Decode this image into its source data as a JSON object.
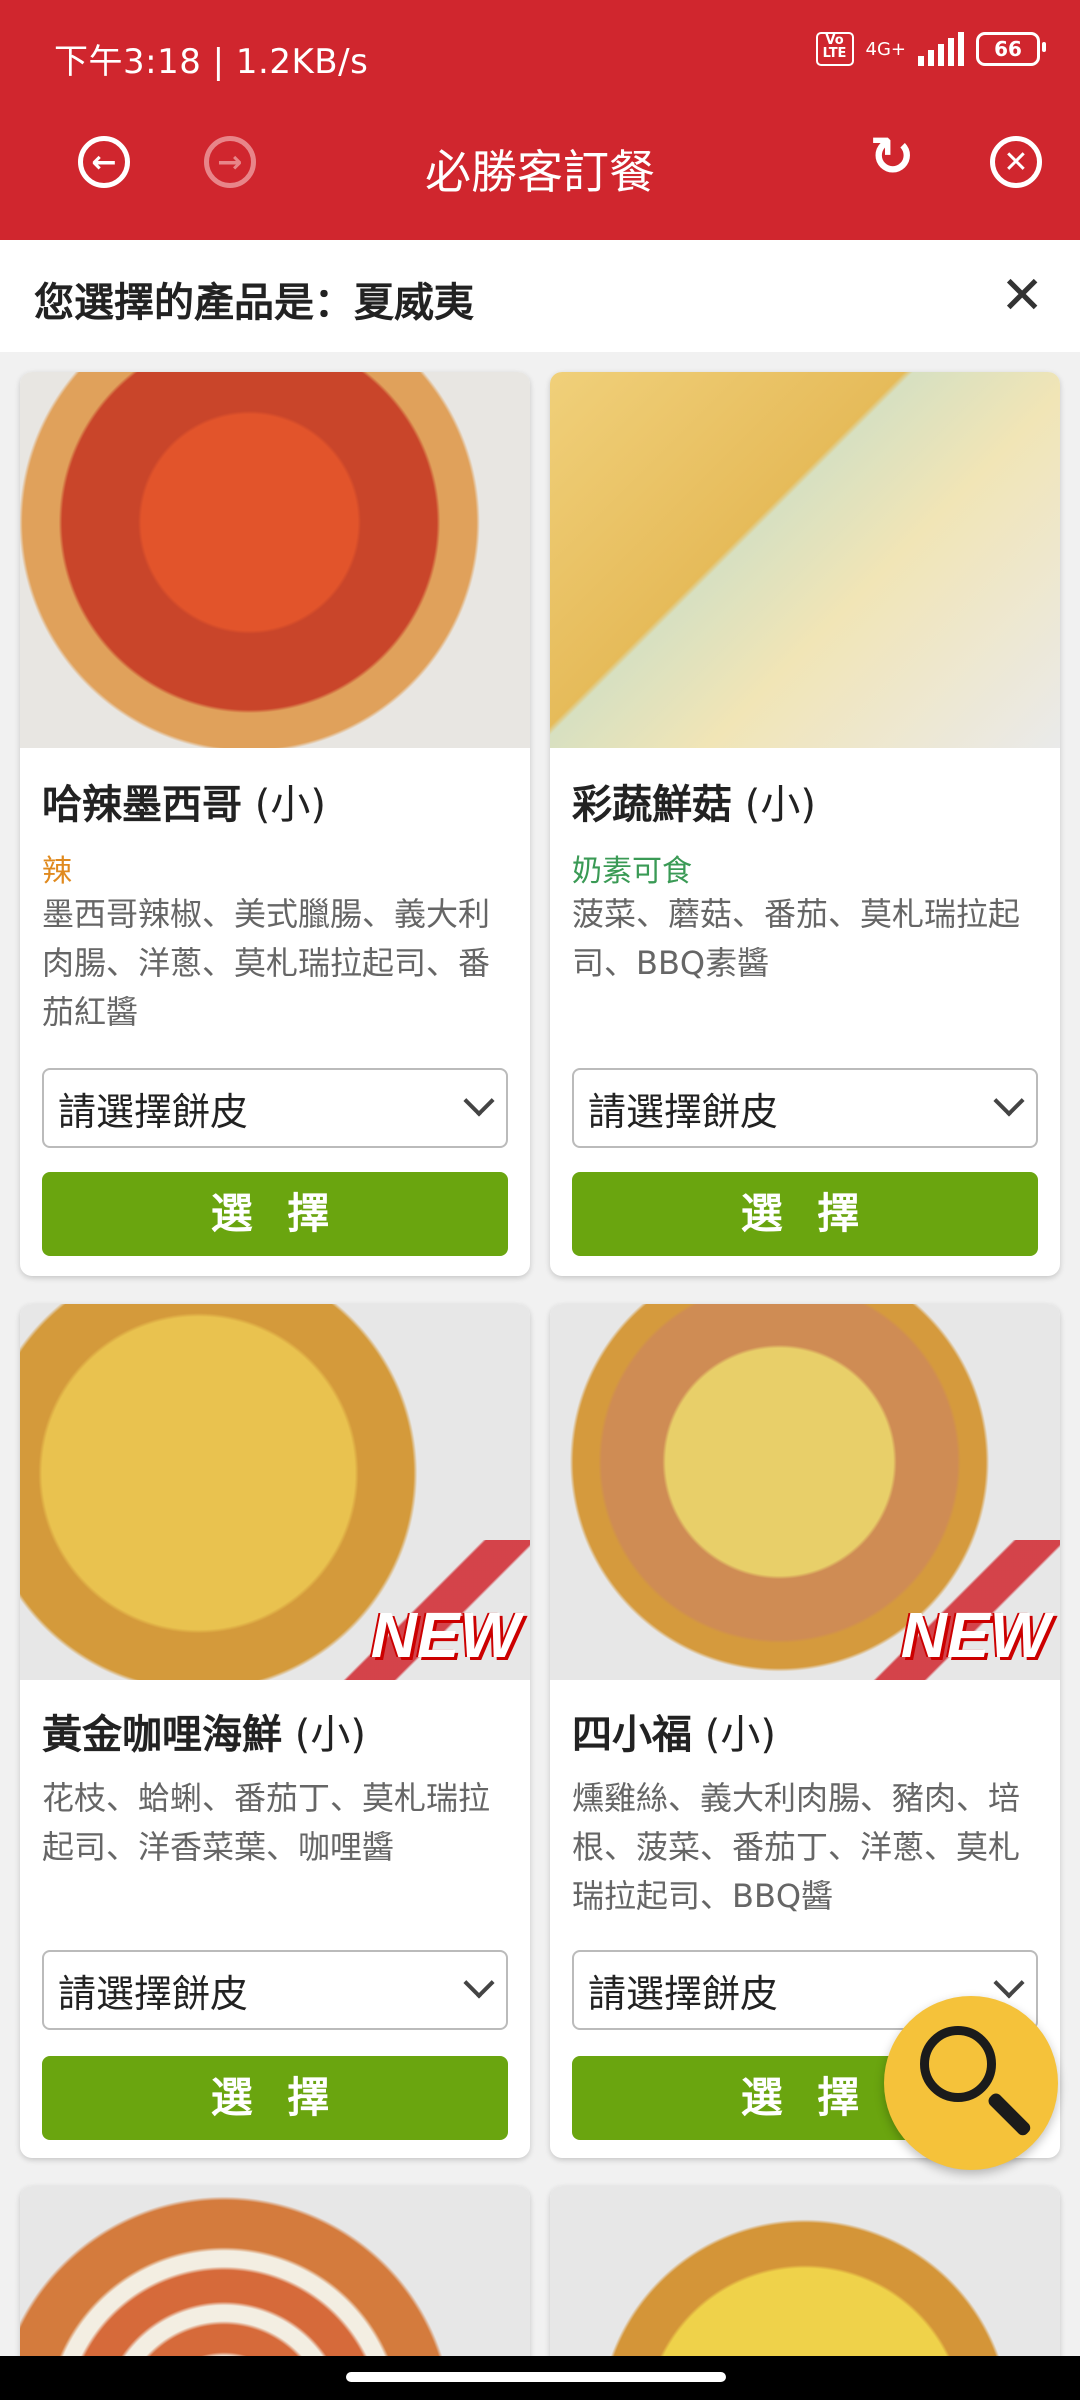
{
  "status_bar": {
    "time_speed": "下午3:18 | 1.2KB/s",
    "volte": "Vo LTE",
    "network": "4G+",
    "battery": "66"
  },
  "header": {
    "title": "必勝客訂餐",
    "icons": [
      "back-icon",
      "forward-icon",
      "refresh-icon",
      "close-icon"
    ],
    "color": "#d0262e"
  },
  "selection": {
    "text": "您選擇的產品是：夏威夷",
    "close": "✕"
  },
  "products": [
    {
      "name": "哈辣墨西哥",
      "size": "(小)",
      "tag": "辣",
      "tag_color": "#e08a1e",
      "desc": "墨西哥辣椒、美式臘腸、義大利肉腸、洋蔥、莫札瑞拉起司、番茄紅醬",
      "select": "請選擇餅皮",
      "button": "選 擇",
      "new": false
    },
    {
      "name": "彩蔬鮮菇",
      "size": "(小)",
      "tag": "奶素可食",
      "tag_color": "#3a9a55",
      "desc": "菠菜、蘑菇、番茄、莫札瑞拉起司、BBQ素醬",
      "select": "請選擇餅皮",
      "button": "選 擇",
      "new": false
    },
    {
      "name": "黃金咖哩海鮮",
      "size": "(小)",
      "tag": "",
      "tag_color": "",
      "desc": "花枝、蛤蜊、番茄丁、莫札瑞拉起司、洋香菜葉、咖哩醬",
      "select": "請選擇餅皮",
      "button": "選 擇",
      "new": true
    },
    {
      "name": "四小福",
      "size": "(小)",
      "tag": "",
      "tag_color": "",
      "desc": "燻雞絲、義大利肉腸、豬肉、培根、菠菜、番茄丁、洋蔥、莫札瑞拉起司、BBQ醬",
      "select": "請選擇餅皮",
      "button": "選 擇",
      "new": true
    }
  ],
  "badge_text": "NEW",
  "accent_green": "#6aa50f"
}
